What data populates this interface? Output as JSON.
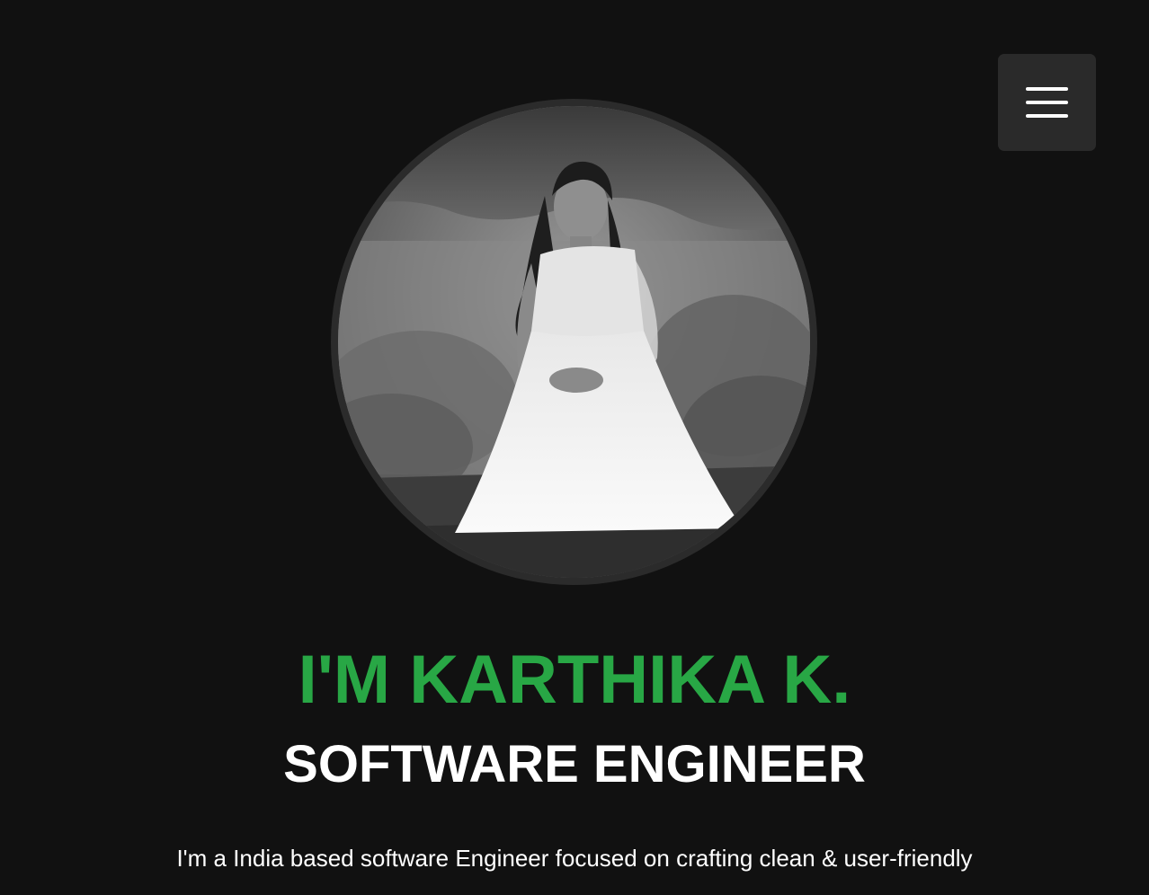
{
  "header": {
    "menu_icon": "hamburger-menu-icon"
  },
  "hero": {
    "name": "I'M KARTHIKA K.",
    "role": "SOFTWARE ENGINEER",
    "intro": "I'm a India based software Engineer focused on crafting clean & user-friendly",
    "accent_color": "#28a745",
    "background_color": "#111111"
  }
}
